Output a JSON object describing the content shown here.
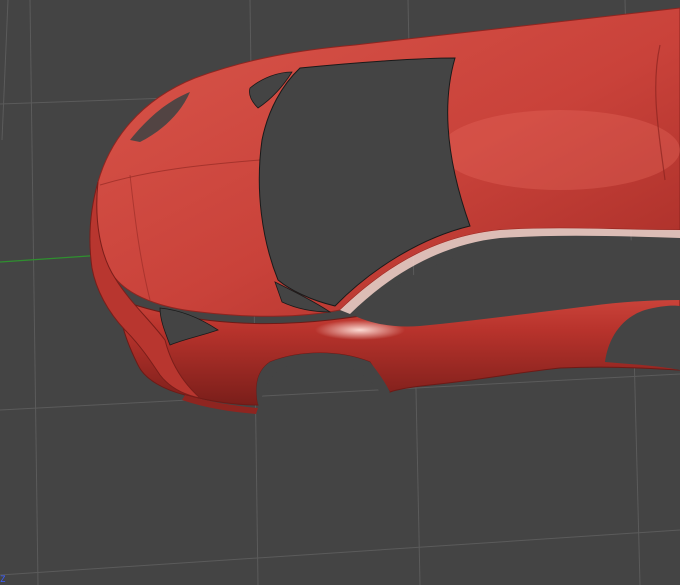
{
  "viewport": {
    "background_color": "#444444",
    "grid_color": "#5b5b5b",
    "x_axis_color": "#2f8f2f",
    "z_axis_color": "#3a5cff",
    "axis_gizmo_label": "Z"
  },
  "model": {
    "body_color": "#c9423a",
    "highlight_color": "#f2b3a8",
    "shadow_color": "#7a1e1a",
    "edge_color": "#1a1a1a"
  }
}
